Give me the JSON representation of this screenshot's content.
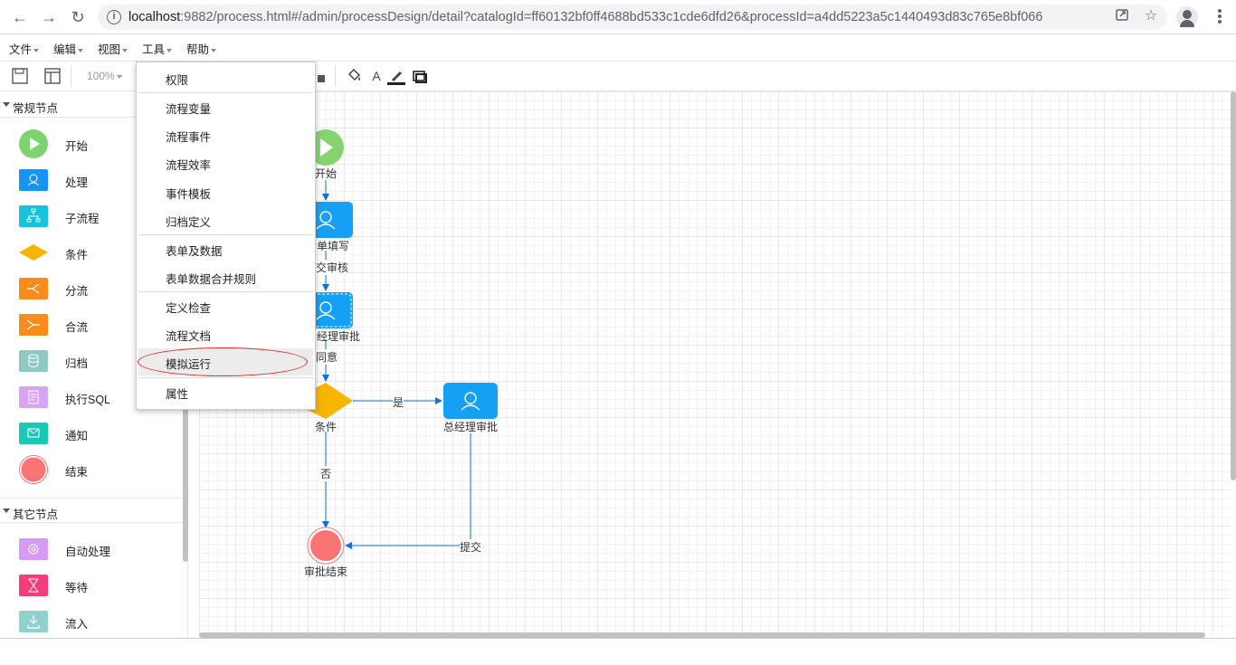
{
  "browser": {
    "url_host": "localhost",
    "url_rest": ":9882/process.html#/admin/processDesign/detail?catalogId=ff60132bf0ff4688bd533c1cde6dfd26&processId=a4dd5223a5c1440493d83c765e8bf066",
    "back_icon": "arrow-left-icon",
    "forward_icon": "arrow-right-icon",
    "reload_icon": "reload-icon"
  },
  "menubar": {
    "items": [
      "文件",
      "编辑",
      "视图",
      "工具",
      "帮助"
    ]
  },
  "toolbar": {
    "zoom": "100%"
  },
  "sidebar": {
    "sections": [
      {
        "title": "常规节点"
      },
      {
        "title": "其它节点"
      }
    ],
    "normal_nodes": [
      {
        "label": "开始",
        "icon": "start-icon",
        "color": "#7dd36e"
      },
      {
        "label": "处理",
        "icon": "user-task-icon",
        "color": "#1495f5"
      },
      {
        "label": "子流程",
        "icon": "subprocess-icon",
        "color": "#17c3dc"
      },
      {
        "label": "条件",
        "icon": "condition-icon",
        "color": "#f7b500"
      },
      {
        "label": "分流",
        "icon": "split-icon",
        "color": "#f98c1a"
      },
      {
        "label": "合流",
        "icon": "merge-icon",
        "color": "#f98c1a"
      },
      {
        "label": "归档",
        "icon": "archive-icon",
        "color": "#8fc9c4"
      },
      {
        "label": "执行SQL",
        "icon": "sql-icon",
        "color": "#d7a3f2"
      },
      {
        "label": "通知",
        "icon": "notify-icon",
        "color": "#19c9b8"
      },
      {
        "label": "结束",
        "icon": "end-icon",
        "color": "#fb7474"
      }
    ],
    "other_nodes": [
      {
        "label": "自动处理",
        "icon": "auto-process-icon",
        "color": "#d79bf6"
      },
      {
        "label": "等待",
        "icon": "wait-icon",
        "color": "#f53d7c"
      },
      {
        "label": "流入",
        "icon": "inflow-icon",
        "color": "#8fd1cf"
      }
    ]
  },
  "tools_menu": {
    "items": [
      {
        "label": "权限"
      },
      {
        "label": "流程变量"
      },
      {
        "label": "流程事件"
      },
      {
        "label": "流程效率"
      },
      {
        "label": "事件模板"
      },
      {
        "label": "归档定义"
      },
      {
        "label": "表单及数据"
      },
      {
        "label": "表单数据合并规则"
      },
      {
        "label": "定义检查"
      },
      {
        "label": "流程文档"
      },
      {
        "label": "模拟运行"
      },
      {
        "label": "属性"
      }
    ],
    "highlighted": "模拟运行"
  },
  "diagram": {
    "nodes": {
      "start": "开始",
      "fill_form": "单填写",
      "manager_approve": "经理审批",
      "condition": "条件",
      "gm_approve": "总经理审批",
      "end": "审批结束"
    },
    "edges": {
      "submit_review": "交审核",
      "agree": "同意",
      "yes": "是",
      "no": "否",
      "submit": "提交"
    },
    "colors": {
      "start": "#86d46f",
      "task": "#14a0f5",
      "condition": "#f7b500",
      "end": "#fb7474",
      "edge": "#1570d8"
    }
  }
}
